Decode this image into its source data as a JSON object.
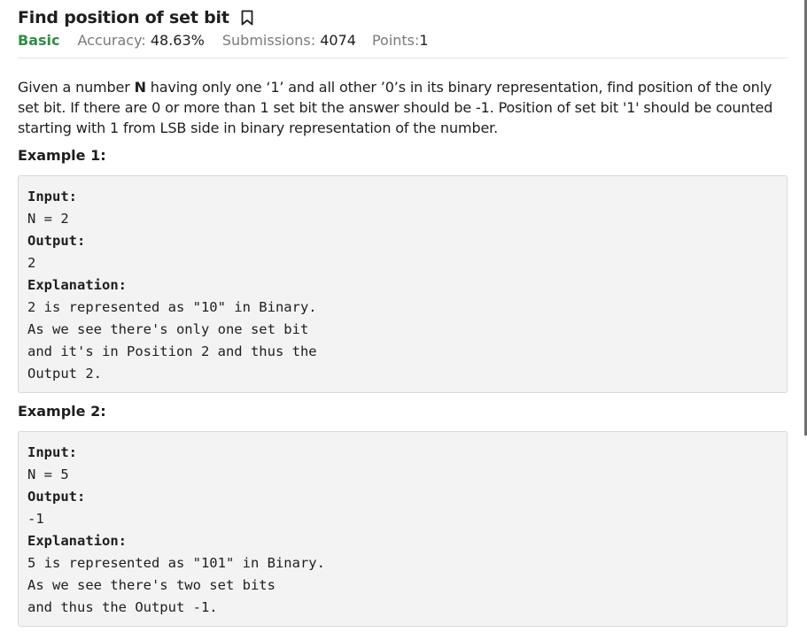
{
  "problem": {
    "title": "Find position of set bit",
    "difficulty": "Basic",
    "accuracy_label": "Accuracy:",
    "accuracy_value": "48.63%",
    "submissions_label": "Submissions:",
    "submissions_value": "4074",
    "points_label": "Points:",
    "points_value": "1"
  },
  "statement": {
    "part1": "Given a number ",
    "n_symbol": "N",
    "part2": " having only one ‘1’ and all other ’0’s in its binary representation, find position of the only set bit. If there are 0 or more than 1 set bit the answer should be -1. Position of  set bit '1' should be counted starting with 1 from LSB side in binary representation of the number."
  },
  "examples": [
    {
      "heading": "Example 1:",
      "lines": [
        "Input:",
        "N = 2",
        "Output:",
        "2",
        "Explanation:",
        "2 is represented as \"10\" in Binary.",
        "As we see there's only one set bit",
        "and it's in Position 2 and thus the",
        "Output 2."
      ]
    },
    {
      "heading": "Example 2:",
      "lines": [
        "Input:",
        "N = 5",
        "Output:",
        "-1",
        "Explanation:",
        "5 is represented as \"101\" in Binary.",
        "As we see there's two set bits",
        "and thus the Output -1."
      ]
    }
  ],
  "icons": {
    "bookmark": "bookmark-icon"
  },
  "colors": {
    "difficulty": "#2f8d46",
    "muted": "#7a7a7a",
    "code_bg": "#f3f3f3"
  }
}
